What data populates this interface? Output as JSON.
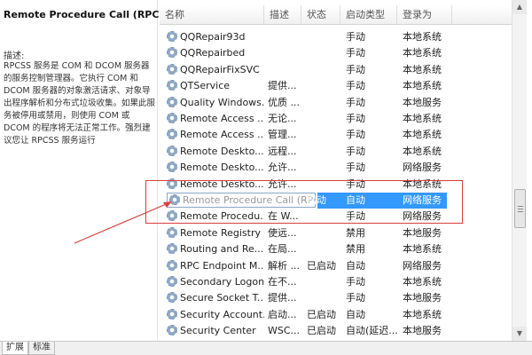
{
  "service_detail": {
    "title": "Remote Procedure Call (RPC)",
    "description_label": "描述:",
    "description": "RPCSS 服务是 COM 和 DCOM 服务器的服务控制管理器。它执行 COM 和 DCOM 服务器的对象激活请求、对象导出程序解析和分布式垃圾收集。如果此服务被停用或禁用，则使用 COM 或 DCOM 的程序将无法正常工作。强烈建议您让 RPCSS 服务运行"
  },
  "columns": [
    "名称",
    "描述",
    "状态",
    "启动类型",
    "登录为"
  ],
  "services": [
    {
      "name": "QQRepair93d",
      "desc": "",
      "status": "",
      "startup": "手动",
      "logon": "本地系统"
    },
    {
      "name": "QQRepairbed",
      "desc": "",
      "status": "",
      "startup": "手动",
      "logon": "本地系统"
    },
    {
      "name": "QQRepairFixSVC",
      "desc": "",
      "status": "",
      "startup": "手动",
      "logon": "本地系统"
    },
    {
      "name": "QTService",
      "desc": "提供...",
      "status": "",
      "startup": "手动",
      "logon": "本地系统"
    },
    {
      "name": "Quality Windows...",
      "desc": "优质 ...",
      "status": "",
      "startup": "手动",
      "logon": "本地服务"
    },
    {
      "name": "Remote Access ...",
      "desc": "无论...",
      "status": "",
      "startup": "手动",
      "logon": "本地系统"
    },
    {
      "name": "Remote Access ...",
      "desc": "管理...",
      "status": "",
      "startup": "手动",
      "logon": "本地系统"
    },
    {
      "name": "Remote Deskto...",
      "desc": "远程...",
      "status": "",
      "startup": "手动",
      "logon": "本地系统"
    },
    {
      "name": "Remote Deskto...",
      "desc": "允许...",
      "status": "",
      "startup": "手动",
      "logon": "网络服务"
    },
    {
      "name": "Remote Deskto...",
      "desc": "允许...",
      "status": "",
      "startup": "手动",
      "logon": "本地系统"
    },
    {
      "name": "Remote Procedure Call (RPC)",
      "desc": "",
      "status": "启动",
      "startup": "自动",
      "logon": "网络服务"
    },
    {
      "name": "Remote Procedu...",
      "desc": "在 W...",
      "status": "",
      "startup": "手动",
      "logon": "网络服务"
    },
    {
      "name": "Remote Registry",
      "desc": "使远...",
      "status": "",
      "startup": "禁用",
      "logon": "本地服务"
    },
    {
      "name": "Routing and Re...",
      "desc": "在局...",
      "status": "",
      "startup": "禁用",
      "logon": "本地系统"
    },
    {
      "name": "RPC Endpoint M...",
      "desc": "解析 ...",
      "status": "已启动",
      "startup": "自动",
      "logon": "网络服务"
    },
    {
      "name": "Secondary Logon",
      "desc": "在不...",
      "status": "",
      "startup": "手动",
      "logon": "本地系统"
    },
    {
      "name": "Secure Socket T...",
      "desc": "提供...",
      "status": "",
      "startup": "手动",
      "logon": "本地服务"
    },
    {
      "name": "Security Account...",
      "desc": "启动...",
      "status": "已启动",
      "startup": "自动",
      "logon": "本地系统"
    },
    {
      "name": "Security Center",
      "desc": "WSC...",
      "status": "已启动",
      "startup": "自动(延迟...",
      "logon": "本地服务"
    }
  ],
  "tabs": [
    "扩展",
    "标准"
  ],
  "colors": {
    "selection": "#3399ff",
    "highlight_box": "#d6403e"
  },
  "icons": {
    "service": "gear-icon"
  }
}
